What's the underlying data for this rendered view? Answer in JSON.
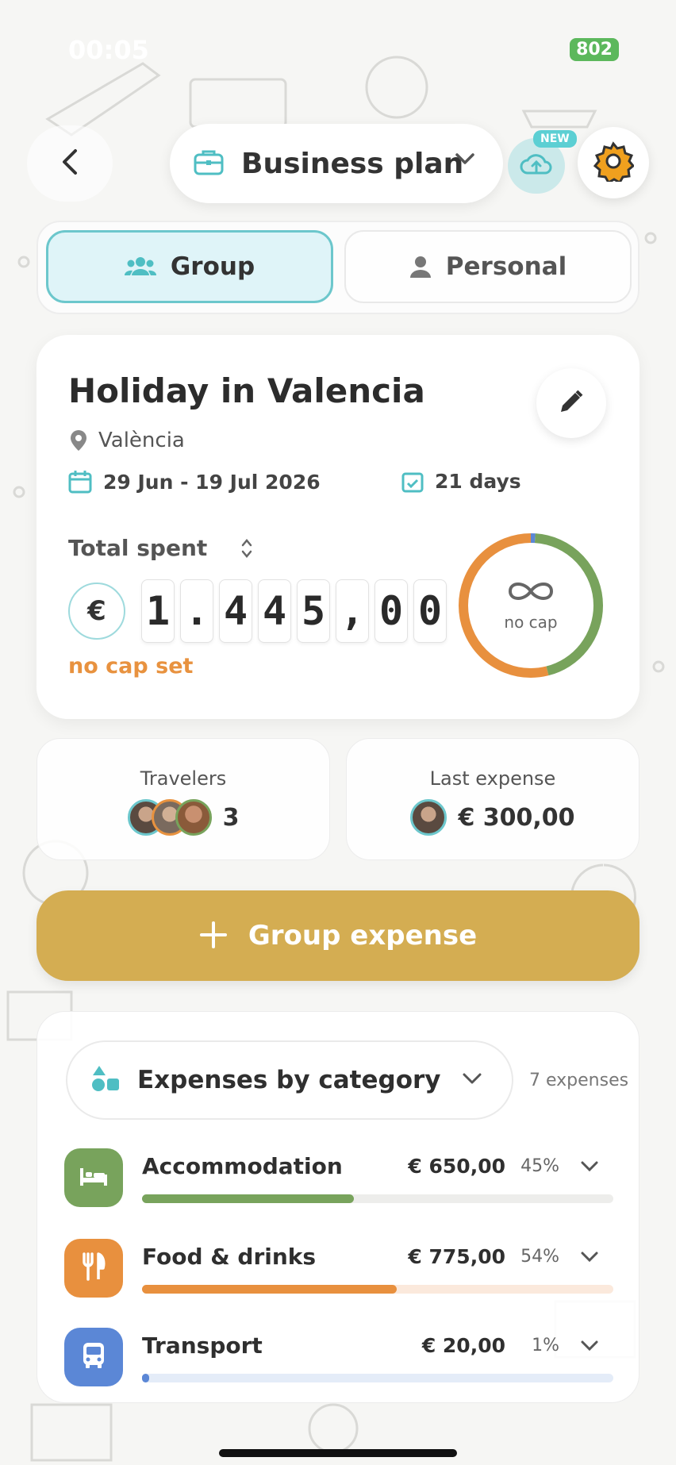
{
  "status_bar": {
    "time": "00:05",
    "battery": "802"
  },
  "header": {
    "plan_label": "Business plan",
    "new_badge": "NEW"
  },
  "tabs": [
    {
      "label": "Group",
      "selected": true
    },
    {
      "label": "Personal",
      "selected": false
    }
  ],
  "trip": {
    "title": "Holiday in Valencia",
    "location": "València",
    "dates": "29 Jun - 19 Jul 2026",
    "duration": "21 days",
    "total_label": "Total spent",
    "currency_symbol": "€",
    "total_digits": [
      "1",
      ".",
      "4",
      "4",
      "5",
      ",",
      "0",
      "0"
    ],
    "cap_status": "no cap set",
    "ring_label": "no cap"
  },
  "travelers": {
    "title": "Travelers",
    "count": "3"
  },
  "last_expense": {
    "title": "Last expense",
    "amount": "€ 300,00"
  },
  "cta": {
    "label": "Group expense"
  },
  "expenses": {
    "selector_label": "Expenses by category",
    "count_label": "7 expenses",
    "categories": [
      {
        "name": "Accommodation",
        "amount": "€ 650,00",
        "percent": "45%",
        "share": 0.45,
        "color": "#78a35c",
        "track": "#ededeb",
        "icon": "bed-icon"
      },
      {
        "name": "Food & drinks",
        "amount": "€ 775,00",
        "percent": "54%",
        "share": 0.54,
        "color": "#e8903e",
        "track": "#fbe9dc",
        "icon": "utensils-icon"
      },
      {
        "name": "Transport",
        "amount": "€ 20,00",
        "percent": "1%",
        "share": 0.01,
        "color": "#5b87d6",
        "track": "#e4ecf8",
        "icon": "bus-icon"
      }
    ]
  },
  "colors": {
    "accent_teal": "#6cc7cc",
    "cta_gold": "#d4ad52",
    "warning_orange": "#e8923f",
    "ring_green": "#78a35c",
    "ring_orange": "#e8903e",
    "ring_blue": "#5b87d6"
  }
}
